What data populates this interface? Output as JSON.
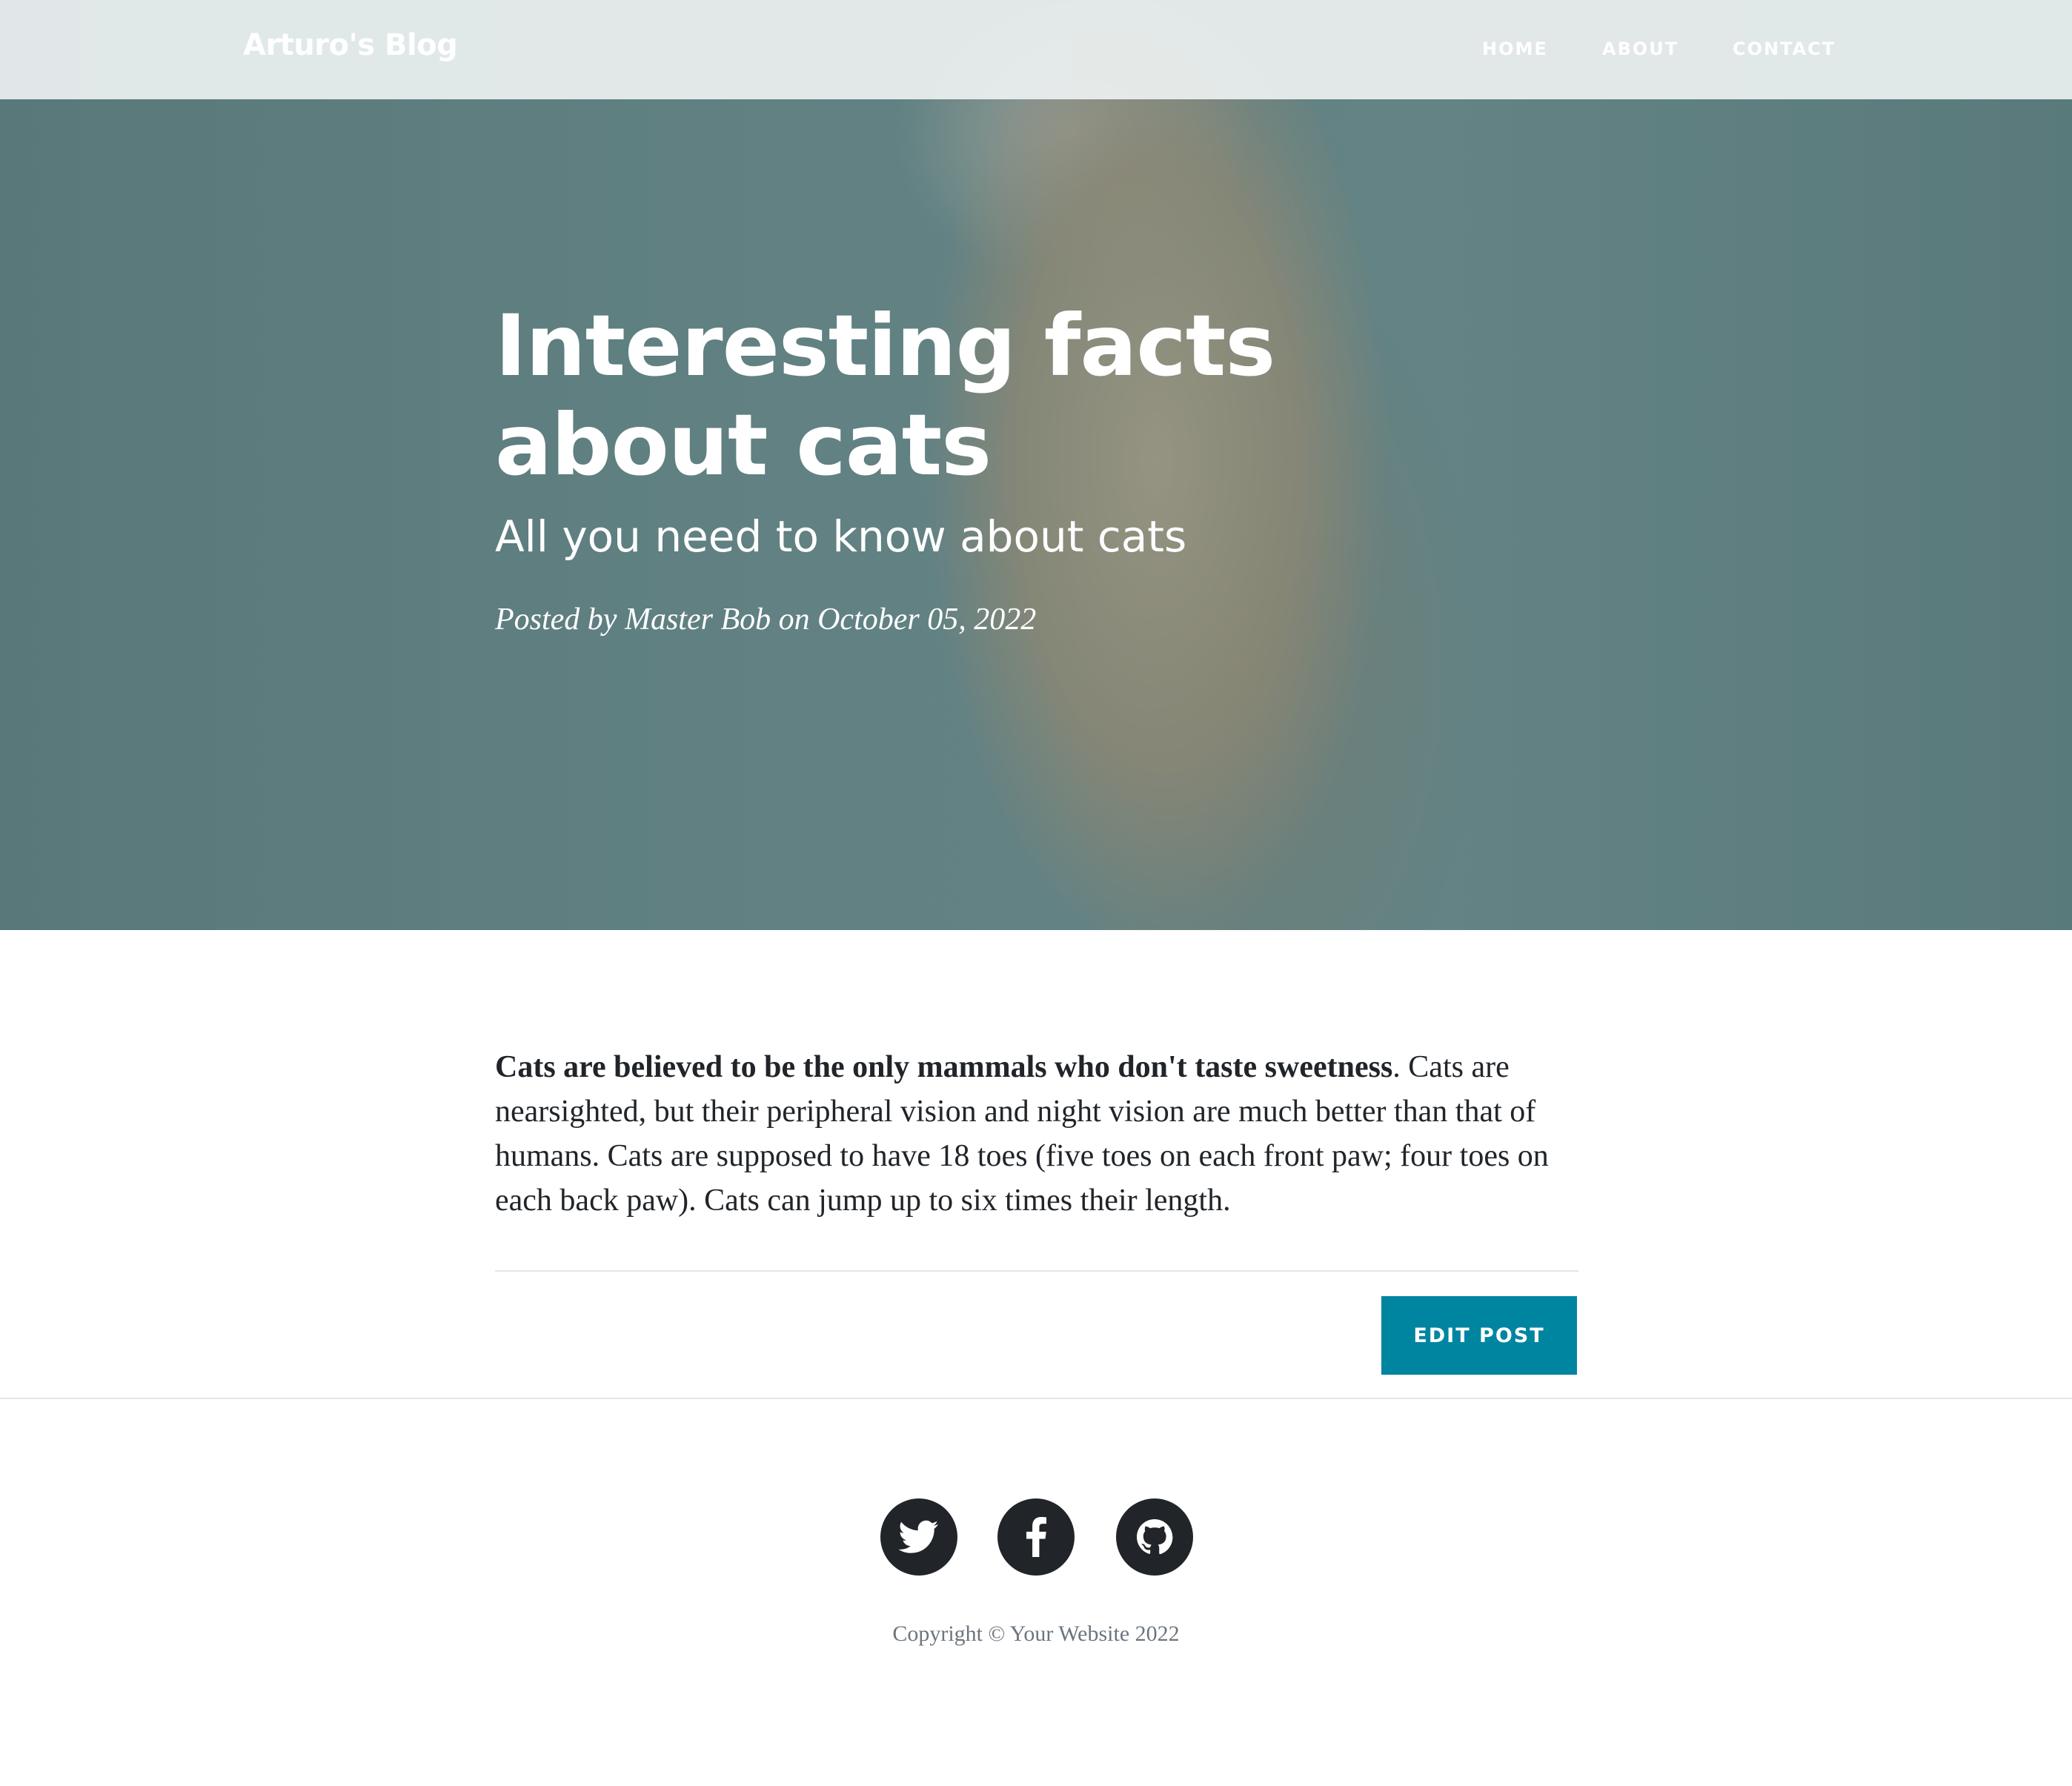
{
  "navbar": {
    "brand": "Arturo's Blog",
    "links": [
      {
        "label": "HOME"
      },
      {
        "label": "ABOUT"
      },
      {
        "label": "CONTACT"
      }
    ]
  },
  "hero": {
    "image_subject": "kitten looking up",
    "title": "Interesting facts about cats",
    "subtitle": "All you need to know about cats",
    "meta": "Posted by Master Bob on October 05, 2022"
  },
  "article": {
    "bold_lead": "Cats are believed to be the only mammals who don't taste sweetness",
    "body": ". Cats are nearsighted, but their peripheral vision and night vision are much better than that of humans. Cats are supposed to have 18 toes (five toes on each front paw; four toes on each back paw). Cats can jump up to six times their length."
  },
  "actions": {
    "edit_label": "EDIT POST"
  },
  "footer": {
    "social": [
      {
        "icon": "twitter-icon"
      },
      {
        "icon": "facebook-icon"
      },
      {
        "icon": "github-icon"
      }
    ],
    "copyright": "Copyright © Your Website 2022"
  },
  "colors": {
    "accent": "#0085a1",
    "text": "#212529",
    "muted": "#6c757d"
  }
}
